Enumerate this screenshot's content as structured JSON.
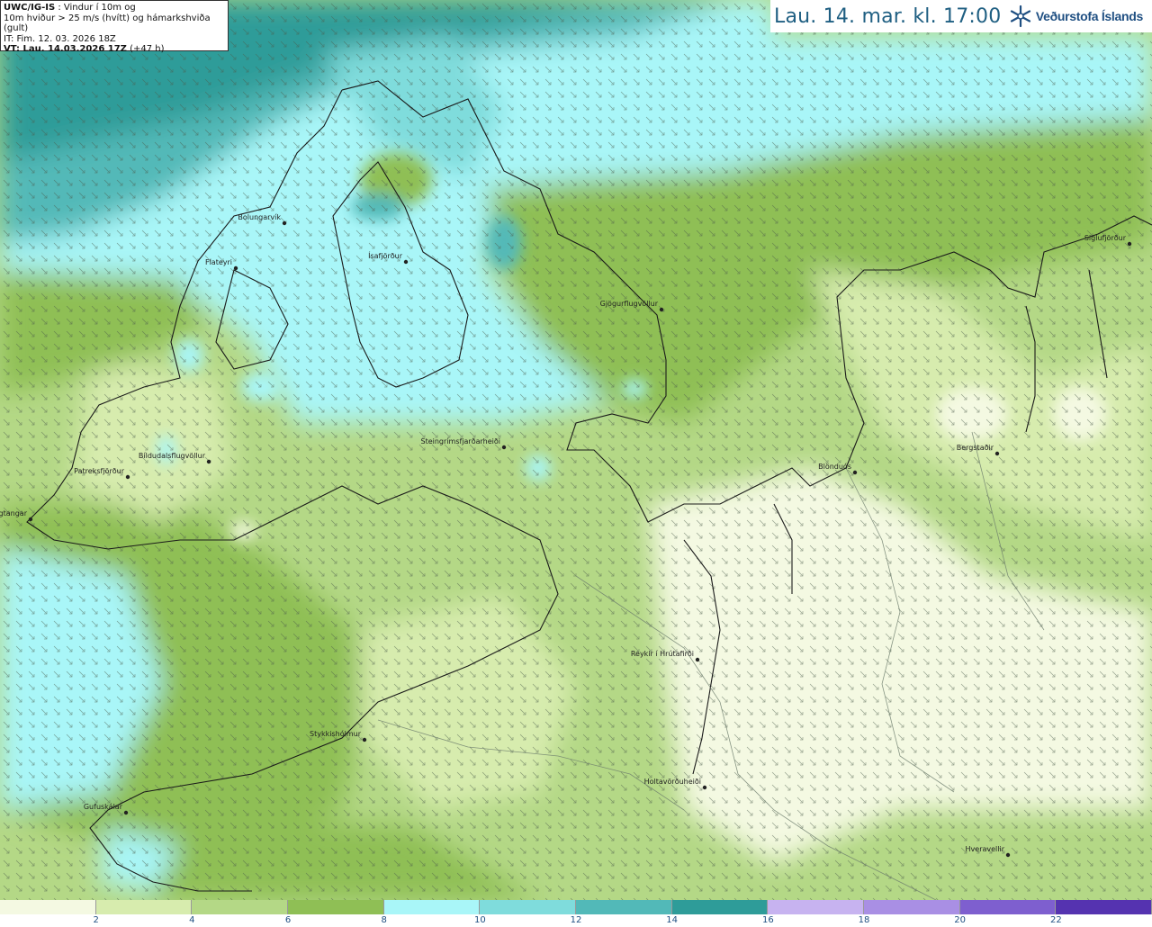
{
  "info": {
    "line1_bold": "UWC/IG-IS",
    "line1_rest": " : Vindur í 10m og",
    "line2": "10m hviður > 25 m/s (hvítt) og hámarkshviða (gult)",
    "line3": "IT: Fim. 12. 03. 2026 18Z",
    "line4_bold": "VT: Lau. 14.03.2026 17Z",
    "line4_rest": " (+47 h)"
  },
  "title": "Lau. 14. mar. kl. 17:00",
  "logo": {
    "text": "Veðurstofa Íslands",
    "icon": "snowflake-logo-icon"
  },
  "places": [
    {
      "name": "Bolungarvík"
    },
    {
      "name": "Flateyri"
    },
    {
      "name": "Ísafjörður"
    },
    {
      "name": "Gjögurflugvöllur"
    },
    {
      "name": "Siglufjörður"
    },
    {
      "name": "Patreksfjörður"
    },
    {
      "name": "Bíldudalsflugvöllur"
    },
    {
      "name": "Bjargtangar"
    },
    {
      "name": "Steingrímsfjarðarheiði"
    },
    {
      "name": "Blönduós"
    },
    {
      "name": "Bergstaðir"
    },
    {
      "name": "Reykir í Hrútafirði"
    },
    {
      "name": "Stykkishólmur"
    },
    {
      "name": "Holtavörðuheiði"
    },
    {
      "name": "Gufuskálar"
    },
    {
      "name": "Hveravellir"
    }
  ],
  "legend": {
    "colors": [
      "#f4f9e2",
      "#d7ecae",
      "#b4d886",
      "#8fbf55",
      "#a9f6f8",
      "#7fdcdc",
      "#52b9b8",
      "#2e9c99",
      "#c7b3f0",
      "#a98fe4",
      "#7e5fcf",
      "#5533b0"
    ],
    "ticks": [
      "2",
      "4",
      "6",
      "8",
      "10",
      "12",
      "14",
      "16",
      "18",
      "20",
      "22"
    ]
  }
}
